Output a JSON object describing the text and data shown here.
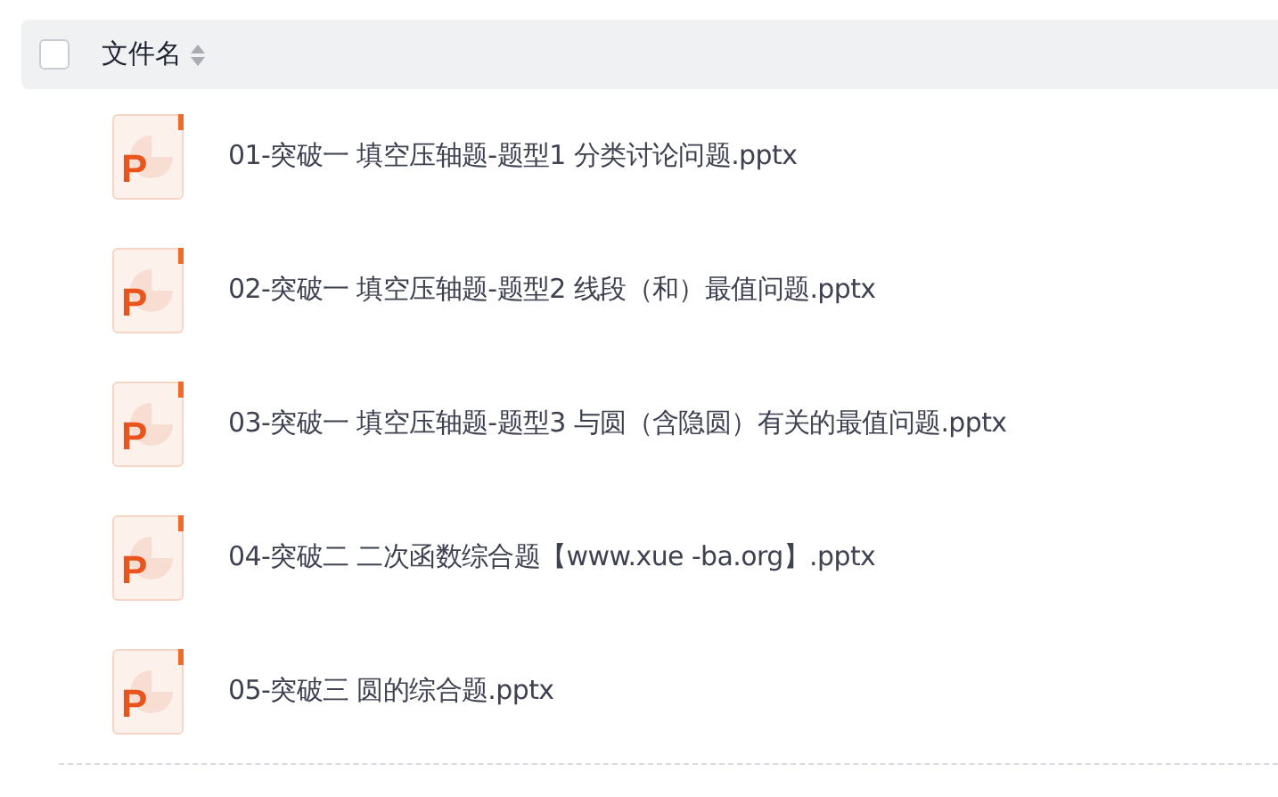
{
  "header": {
    "checked": false,
    "column_label": "文件名"
  },
  "files": [
    {
      "kind": "pptx",
      "icon_label": "P",
      "name": "01-突破一 填空压轴题-题型1 分类讨论问题.pptx"
    },
    {
      "kind": "pptx",
      "icon_label": "P",
      "name": "02-突破一 填空压轴题-题型2 线段（和）最值问题.pptx"
    },
    {
      "kind": "pptx",
      "icon_label": "P",
      "name": "03-突破一 填空压轴题-题型3 与圆（含隐圆）有关的最值问题.pptx"
    },
    {
      "kind": "pptx",
      "icon_label": "P",
      "name": "04-突破二 二次函数综合题【www.xue -ba.org】.pptx"
    },
    {
      "kind": "pptx",
      "icon_label": "P",
      "name": "05-突破三 圆的综合题.pptx"
    }
  ]
}
